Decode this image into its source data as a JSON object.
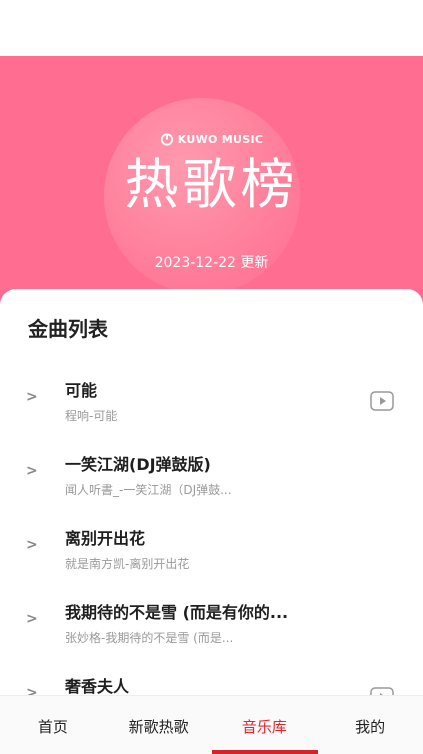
{
  "hero": {
    "brand": "KUWO MUSIC",
    "title": "热歌榜",
    "date": "2023-12-22 更新"
  },
  "list": {
    "title": "金曲列表",
    "songs": [
      {
        "title": "可能",
        "subtitle": "程响-可能",
        "has_video": true
      },
      {
        "title": "一笑江湖(DJ弹鼓版)",
        "subtitle": "闻人听書_-一笑江湖（DJ弹鼓...",
        "has_video": false
      },
      {
        "title": "离别开出花",
        "subtitle": "就是南方凯-离别开出花",
        "has_video": false
      },
      {
        "title": "我期待的不是雪 (而是有你的...",
        "subtitle": "张妙格-我期待的不是雪 (而是...",
        "has_video": false
      },
      {
        "title": "奢香夫人",
        "subtitle": "",
        "has_video": true
      }
    ]
  },
  "tabs": [
    {
      "label": "首页"
    },
    {
      "label": "新歌热歌"
    },
    {
      "label": "音乐库"
    },
    {
      "label": "我的"
    }
  ],
  "active_tab": 2,
  "colors": {
    "hero_bg": "#ff6d91",
    "accent": "#e8242b"
  }
}
